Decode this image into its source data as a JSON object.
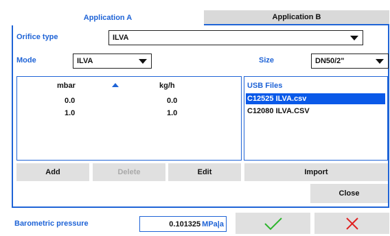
{
  "tabs": [
    {
      "label": "Application A",
      "active": true
    },
    {
      "label": "Application B",
      "active": false
    }
  ],
  "orifice": {
    "label": "Orifice type",
    "value": "ILVA"
  },
  "mode": {
    "label": "Mode",
    "value": "ILVA"
  },
  "size": {
    "label": "Size",
    "value": "DN50/2\""
  },
  "table": {
    "headers": [
      "mbar",
      "kg/h"
    ],
    "sort_indicator": "ascending",
    "rows": [
      [
        "0.0",
        "0.0"
      ],
      [
        "1.0",
        "1.0"
      ]
    ]
  },
  "usb": {
    "title": "USB Files",
    "files": [
      "C12525 ILVA.csv",
      "C12080 ILVA.CSV"
    ],
    "selected_index": 0
  },
  "buttons": {
    "add": "Add",
    "delete": "Delete",
    "edit": "Edit",
    "import": "Import",
    "close": "Close"
  },
  "barometric": {
    "label": "Barometric pressure",
    "value": "0.101325",
    "unit": "MPa|a"
  },
  "icons": {
    "confirm": "check-icon",
    "cancel": "x-icon"
  },
  "colors": {
    "accent": "#1e63d6",
    "selection": "#0a59e8",
    "confirm": "#2db52d",
    "cancel": "#e02020"
  }
}
